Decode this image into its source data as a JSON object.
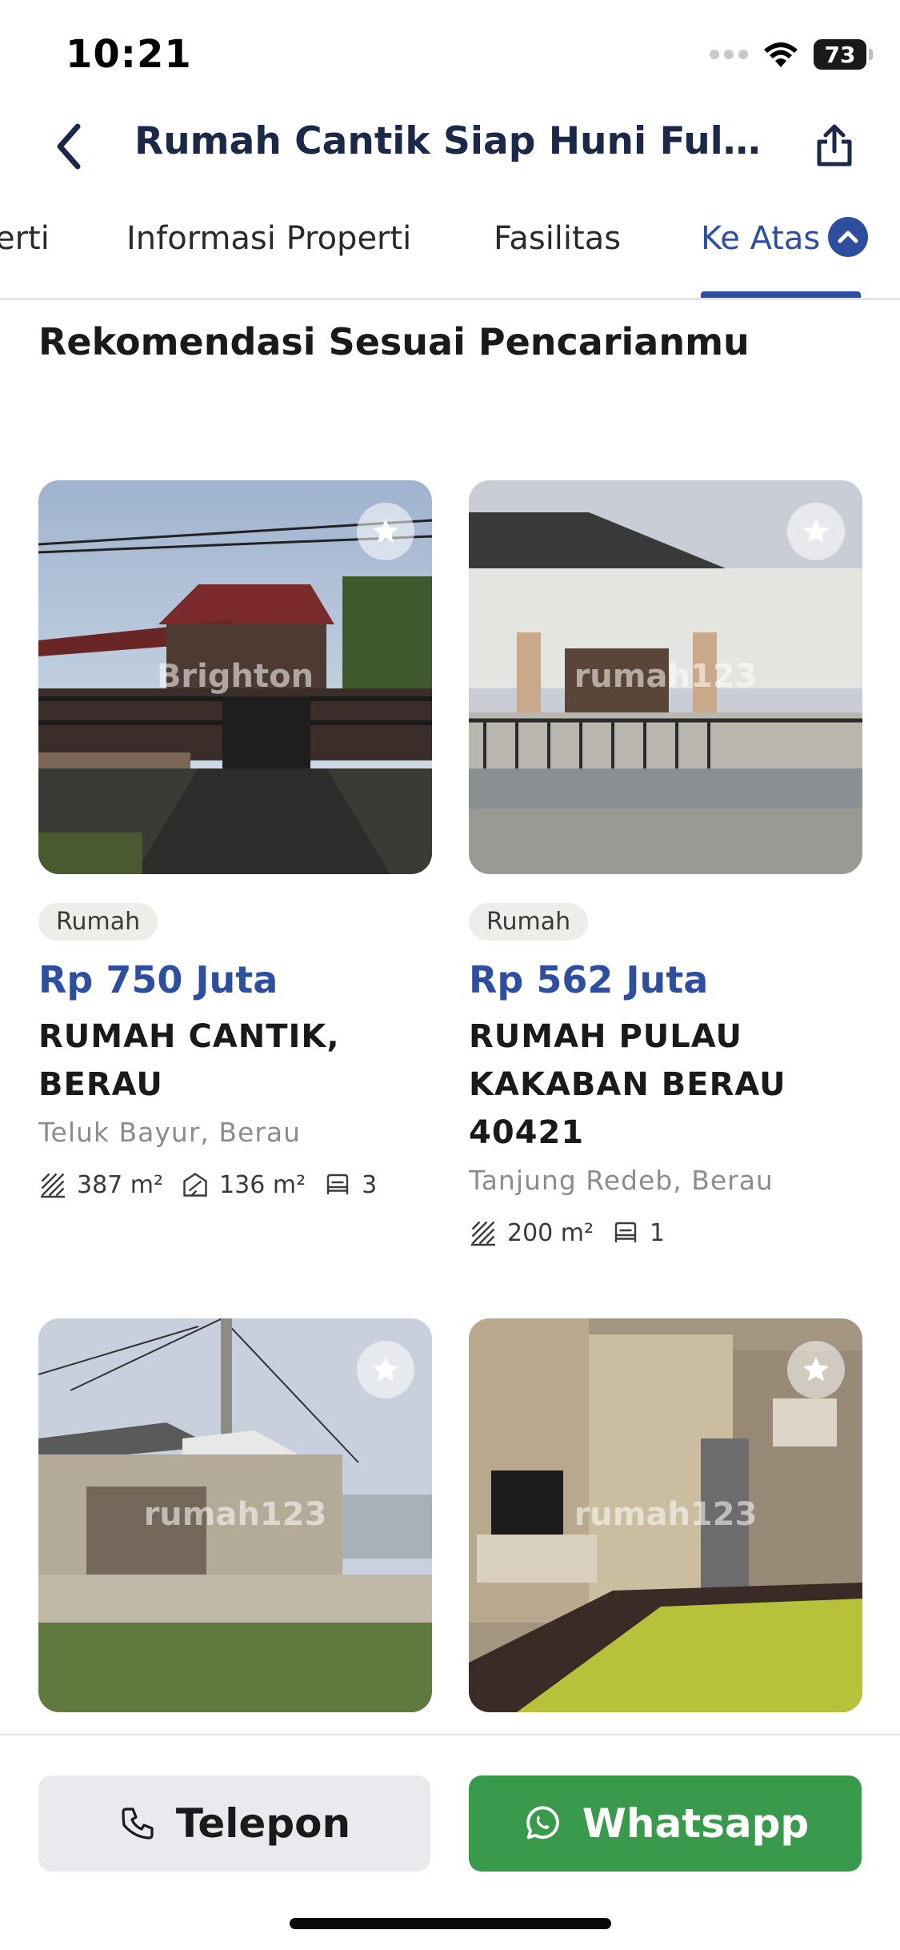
{
  "status_bar": {
    "time": "10:21",
    "battery": "73"
  },
  "header": {
    "title": "Rumah Cantik  Siap Huni Full Furnish",
    "back_icon": "chevron-left-icon",
    "share_icon": "share-icon"
  },
  "tabs": [
    {
      "label": "erti"
    },
    {
      "label": "Informasi Properti"
    },
    {
      "label": "Fasilitas"
    },
    {
      "label": "Ke Atas",
      "active": true
    }
  ],
  "section_title": "Rekomendasi Sesuai Pencarianmu",
  "listings": [
    {
      "type": "Rumah",
      "price": "Rp 750 Juta",
      "title": "RUMAH CANTIK, BERAU",
      "location": "Teluk Bayur, Berau",
      "watermark": "Brighton",
      "land_area": "387 m²",
      "building_area": "136 m²",
      "bedrooms": "3"
    },
    {
      "type": "Rumah",
      "price": "Rp 562 Juta",
      "title": "RUMAH PULAU KAKABAN BERAU 40421",
      "location": "Tanjung Redeb, Berau",
      "watermark": "rumah123",
      "land_area": "200 m²",
      "bedrooms": "1"
    },
    {
      "watermark": "rumah123"
    },
    {
      "watermark": "rumah123"
    }
  ],
  "actions": {
    "telepon_label": "Telepon",
    "whatsapp_label": "Whatsapp"
  },
  "colors": {
    "accent": "#2e4fa0",
    "title": "#1b2848",
    "whatsapp": "#3a9a4c"
  }
}
